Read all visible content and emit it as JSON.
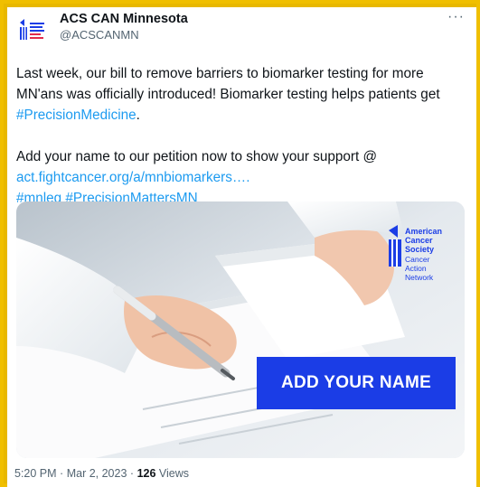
{
  "account": {
    "display_name": "ACS CAN Minnesota",
    "handle": "@ACSCANMN",
    "more_label": "···"
  },
  "tweet": {
    "line1": "Last week, our bill to remove barriers to biomarker testing for more",
    "line2": "MN'ans was officially introduced! Biomarker testing helps patients get",
    "hashtag_precision": "#PrecisionMedicine",
    "period": ".",
    "line4": "Add your name to our petition now to show your support @",
    "url": "act.fightcancer.org/a/mnbiomarkers….",
    "hashtag_mnleg": "#mnleg",
    "hashtag_matters": "#PrecisionMattersMN"
  },
  "media": {
    "cta_label": "ADD YOUR NAME",
    "logo_lines": [
      "American",
      "Cancer",
      "Society",
      "Cancer",
      "Action",
      "Network"
    ]
  },
  "meta": {
    "time": "5:20 PM",
    "sep": "·",
    "date": "Mar 2, 2023",
    "views_count": "126",
    "views_label": "Views"
  },
  "colors": {
    "border": "#e8b800",
    "link": "#1d9bf0",
    "cta": "#1b3de6"
  }
}
